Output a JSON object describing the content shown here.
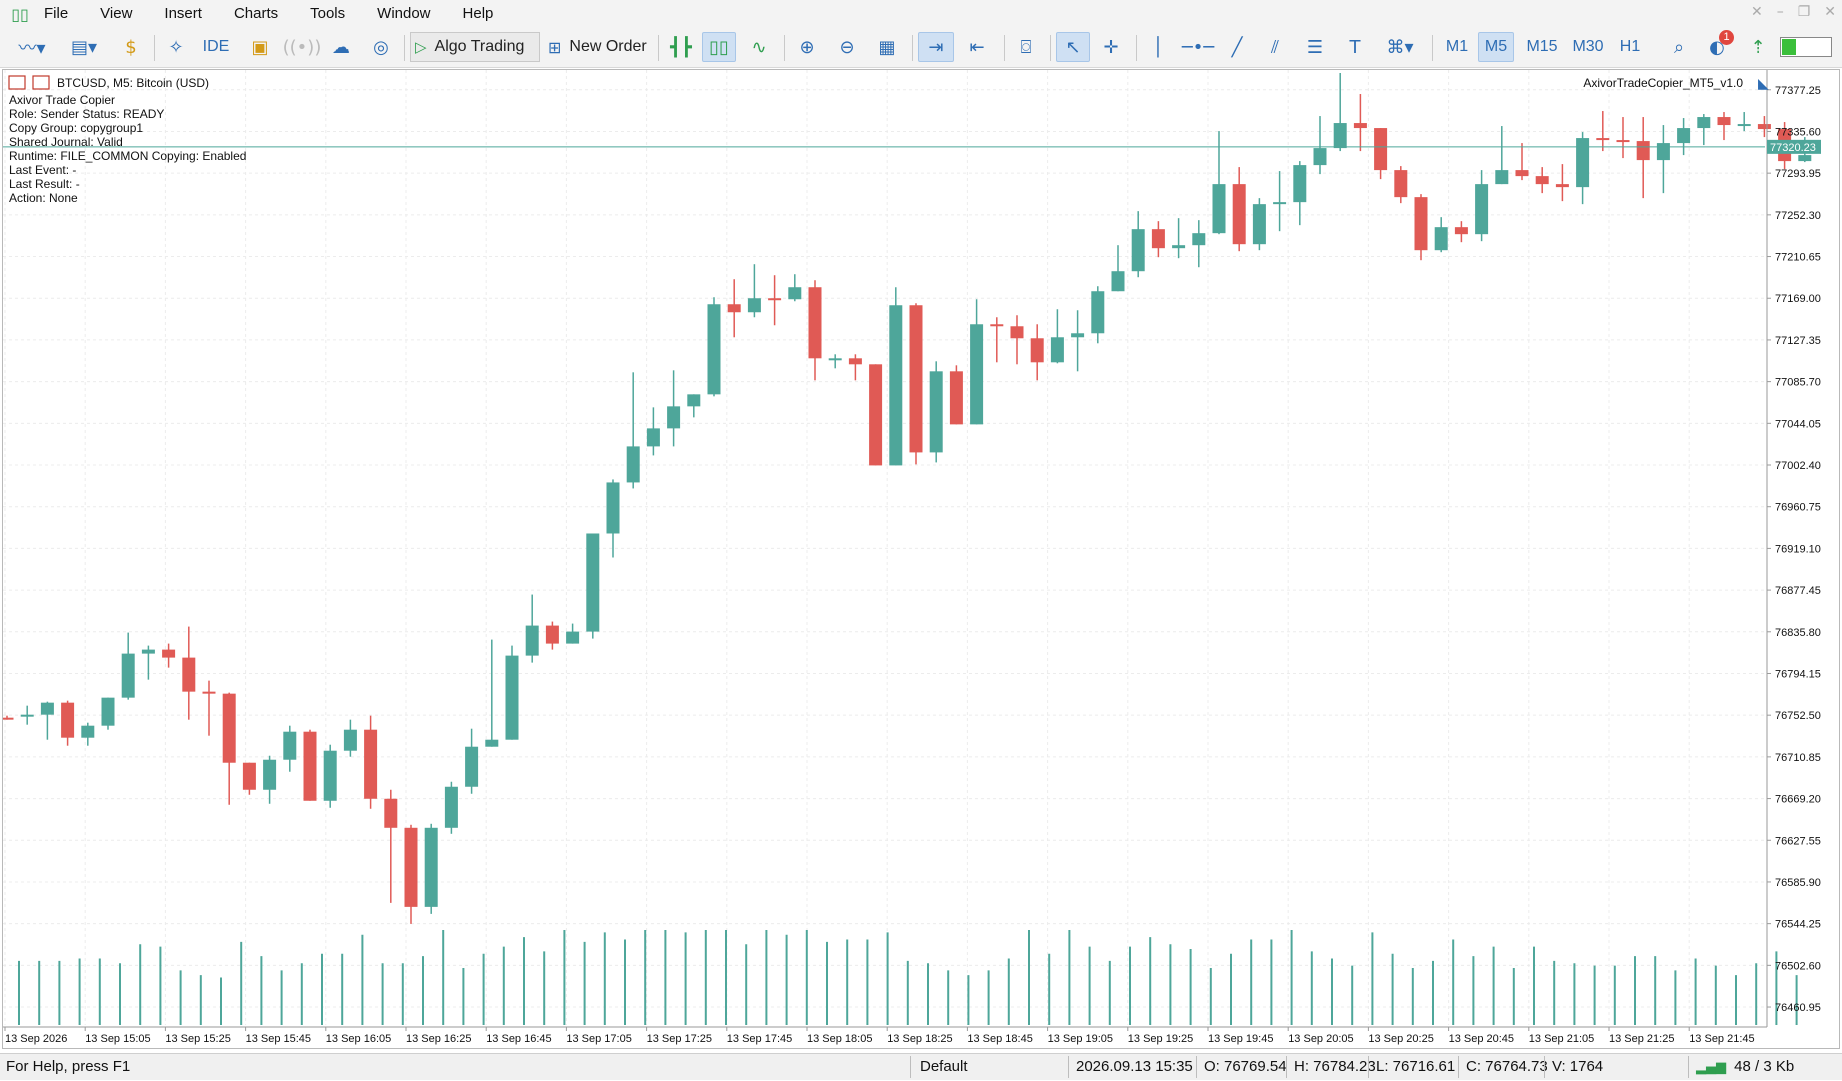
{
  "menu": {
    "items": [
      "File",
      "View",
      "Insert",
      "Charts",
      "Tools",
      "Window",
      "Help"
    ]
  },
  "toolbar": {
    "ide_label": "IDE",
    "algo_trading_label": "Algo Trading",
    "new_order_label": "New Order",
    "timeframes": [
      "M1",
      "M5",
      "M15",
      "M30",
      "H1"
    ],
    "active_timeframe": "M5",
    "alerts_badge": "1"
  },
  "chart": {
    "symbol_header": "BTCUSD, M5:  Bitcoin (USD)",
    "ea_name": "AxivorTradeCopier_MT5_v1.0",
    "info_lines": [
      "Axivor Trade Copier",
      "Role: Sender    Status: READY",
      "Copy Group: copygroup1",
      "Shared Journal: Valid",
      "Runtime: FILE_COMMON    Copying: Enabled",
      "Last Event: -",
      "Last Result: -",
      "Action: None"
    ],
    "current_price": "77320.23",
    "bull_color": "#4ea69a",
    "bear_color": "#e05a55"
  },
  "chart_data": {
    "type": "candlestick",
    "symbol": "BTCUSD",
    "timeframe": "M5",
    "price_ticks": [
      "77377.25",
      "77335.60",
      "77293.95",
      "77252.30",
      "77210.65",
      "77169.00",
      "77127.35",
      "77085.70",
      "77044.05",
      "77002.40",
      "76960.75",
      "76919.10",
      "76877.45",
      "76835.80",
      "76794.15",
      "76752.50",
      "76710.85",
      "76669.20",
      "76627.55",
      "76585.90",
      "76544.25",
      "76502.60",
      "76460.95"
    ],
    "time_ticks": [
      "13 Sep 2026",
      "13 Sep 15:05",
      "13 Sep 15:25",
      "13 Sep 15:45",
      "13 Sep 16:05",
      "13 Sep 16:25",
      "13 Sep 16:45",
      "13 Sep 17:05",
      "13 Sep 17:25",
      "13 Sep 17:45",
      "13 Sep 18:05",
      "13 Sep 18:25",
      "13 Sep 18:45",
      "13 Sep 19:05",
      "13 Sep 19:25",
      "13 Sep 19:45",
      "13 Sep 20:05",
      "13 Sep 20:25",
      "13 Sep 20:45",
      "13 Sep 21:05",
      "13 Sep 21:25",
      "13 Sep 21:45"
    ],
    "ylim": [
      76443,
      77397
    ],
    "current_price": 77320.23,
    "candles": [
      {
        "o": 76750,
        "h": 76752,
        "c": 76749,
        "l": 76748
      },
      {
        "o": 76752,
        "h": 76762,
        "c": 76753,
        "l": 76743
      },
      {
        "o": 76753,
        "h": 76766,
        "c": 76765,
        "l": 76728
      },
      {
        "o": 76765,
        "h": 76767,
        "c": 76730,
        "l": 76722
      },
      {
        "o": 76730,
        "h": 76745,
        "c": 76742,
        "l": 76722
      },
      {
        "o": 76742,
        "h": 76770,
        "c": 76770,
        "l": 76738
      },
      {
        "o": 76770,
        "h": 76835,
        "c": 76814,
        "l": 76768
      },
      {
        "o": 76814,
        "h": 76822,
        "c": 76818,
        "l": 76788
      },
      {
        "o": 76818,
        "h": 76824,
        "c": 76810,
        "l": 76800
      },
      {
        "o": 76810,
        "h": 76841,
        "c": 76776,
        "l": 76748
      },
      {
        "o": 76776,
        "h": 76787,
        "c": 76774,
        "l": 76732
      },
      {
        "o": 76774,
        "h": 76775,
        "c": 76705,
        "l": 76663
      },
      {
        "o": 76705,
        "h": 76705,
        "c": 76678,
        "l": 76673
      },
      {
        "o": 76678,
        "h": 76712,
        "c": 76708,
        "l": 76664
      },
      {
        "o": 76708,
        "h": 76742,
        "c": 76736,
        "l": 76696
      },
      {
        "o": 76736,
        "h": 76738,
        "c": 76667,
        "l": 76667
      },
      {
        "o": 76667,
        "h": 76723,
        "c": 76717,
        "l": 76660
      },
      {
        "o": 76717,
        "h": 76748,
        "c": 76738,
        "l": 76711
      },
      {
        "o": 76738,
        "h": 76752,
        "c": 76669,
        "l": 76659
      },
      {
        "o": 76669,
        "h": 76678,
        "c": 76640,
        "l": 76565
      },
      {
        "o": 76640,
        "h": 76643,
        "c": 76561,
        "l": 76544
      },
      {
        "o": 76561,
        "h": 76644,
        "c": 76640,
        "l": 76554
      },
      {
        "o": 76640,
        "h": 76686,
        "c": 76681,
        "l": 76634
      },
      {
        "o": 76681,
        "h": 76739,
        "c": 76721,
        "l": 76674
      },
      {
        "o": 76721,
        "h": 76828,
        "c": 76728,
        "l": 76730
      },
      {
        "o": 76728,
        "h": 76822,
        "c": 76812,
        "l": 76787
      },
      {
        "o": 76812,
        "h": 76873,
        "c": 76842,
        "l": 76805
      },
      {
        "o": 76842,
        "h": 76846,
        "c": 76824,
        "l": 76818
      },
      {
        "o": 76824,
        "h": 76844,
        "c": 76836,
        "l": 76826
      },
      {
        "o": 76836,
        "h": 76932,
        "c": 76934,
        "l": 76829
      },
      {
        "o": 76934,
        "h": 76988,
        "c": 76985,
        "l": 76910
      },
      {
        "o": 76985,
        "h": 77095,
        "c": 77021,
        "l": 76979
      },
      {
        "o": 77021,
        "h": 77060,
        "c": 77039,
        "l": 77012
      },
      {
        "o": 77039,
        "h": 77097,
        "c": 77061,
        "l": 77021
      },
      {
        "o": 77061,
        "h": 77067,
        "c": 77073,
        "l": 77050
      },
      {
        "o": 77073,
        "h": 77170,
        "c": 77163,
        "l": 77071
      },
      {
        "o": 77163,
        "h": 77188,
        "c": 77155,
        "l": 77130
      },
      {
        "o": 77155,
        "h": 77203,
        "c": 77169,
        "l": 77150
      },
      {
        "o": 77169,
        "h": 77192,
        "c": 77168,
        "l": 77142
      },
      {
        "o": 77168,
        "h": 77193,
        "c": 77180,
        "l": 77166
      },
      {
        "o": 77180,
        "h": 77187,
        "c": 77109,
        "l": 77087
      },
      {
        "o": 77109,
        "h": 77113,
        "c": 77109,
        "l": 77099
      },
      {
        "o": 77109,
        "h": 77113,
        "c": 77103,
        "l": 77087
      },
      {
        "o": 77103,
        "h": 77103,
        "c": 77002,
        "l": 77002
      },
      {
        "o": 77002,
        "h": 77180,
        "c": 77162,
        "l": 77002
      },
      {
        "o": 77162,
        "h": 77164,
        "c": 77015,
        "l": 77003
      },
      {
        "o": 77015,
        "h": 77106,
        "c": 77096,
        "l": 77005
      },
      {
        "o": 77096,
        "h": 77102,
        "c": 77043,
        "l": 77043
      },
      {
        "o": 77043,
        "h": 77168,
        "c": 77143,
        "l": 77043
      },
      {
        "o": 77143,
        "h": 77150,
        "c": 77141,
        "l": 77105
      },
      {
        "o": 77141,
        "h": 77152,
        "c": 77129,
        "l": 77103
      },
      {
        "o": 77129,
        "h": 77143,
        "c": 77105,
        "l": 77087
      },
      {
        "o": 77105,
        "h": 77158,
        "c": 77130,
        "l": 77104
      },
      {
        "o": 77130,
        "h": 77157,
        "c": 77134,
        "l": 77096
      },
      {
        "o": 77134,
        "h": 77181,
        "c": 77176,
        "l": 77124
      },
      {
        "o": 77176,
        "h": 77222,
        "c": 77196,
        "l": 77176
      },
      {
        "o": 77196,
        "h": 77256,
        "c": 77238,
        "l": 77190
      },
      {
        "o": 77238,
        "h": 77246,
        "c": 77219,
        "l": 77210
      },
      {
        "o": 77219,
        "h": 77249,
        "c": 77222,
        "l": 77209
      },
      {
        "o": 77222,
        "h": 77247,
        "c": 77234,
        "l": 77200
      },
      {
        "o": 77234,
        "h": 77336,
        "c": 77283,
        "l": 77233
      },
      {
        "o": 77283,
        "h": 77300,
        "c": 77223,
        "l": 77216
      },
      {
        "o": 77223,
        "h": 77269,
        "c": 77263,
        "l": 77217
      },
      {
        "o": 77263,
        "h": 77296,
        "c": 77265,
        "l": 77236
      },
      {
        "o": 77265,
        "h": 77306,
        "c": 77302,
        "l": 77242
      },
      {
        "o": 77302,
        "h": 77351,
        "c": 77319,
        "l": 77293
      },
      {
        "o": 77319,
        "h": 77394,
        "c": 77344,
        "l": 77316
      },
      {
        "o": 77344,
        "h": 77373,
        "c": 77339,
        "l": 77316
      },
      {
        "o": 77339,
        "h": 77339,
        "c": 77297,
        "l": 77288
      },
      {
        "o": 77297,
        "h": 77301,
        "c": 77270,
        "l": 77264
      },
      {
        "o": 77270,
        "h": 77273,
        "c": 77217,
        "l": 77207
      },
      {
        "o": 77217,
        "h": 77250,
        "c": 77240,
        "l": 77215
      },
      {
        "o": 77240,
        "h": 77246,
        "c": 77233,
        "l": 77225
      },
      {
        "o": 77233,
        "h": 77297,
        "c": 77283,
        "l": 77226
      },
      {
        "o": 77283,
        "h": 77341,
        "c": 77297,
        "l": 77289
      },
      {
        "o": 77297,
        "h": 77324,
        "c": 77291,
        "l": 77287
      },
      {
        "o": 77291,
        "h": 77300,
        "c": 77283,
        "l": 77274
      },
      {
        "o": 77283,
        "h": 77303,
        "c": 77280,
        "l": 77266
      },
      {
        "o": 77280,
        "h": 77335,
        "c": 77329,
        "l": 77263
      },
      {
        "o": 77329,
        "h": 77356,
        "c": 77327,
        "l": 77316
      },
      {
        "o": 77327,
        "h": 77350,
        "c": 77326,
        "l": 77309
      },
      {
        "o": 77326,
        "h": 77350,
        "c": 77307,
        "l": 77269
      },
      {
        "o": 77307,
        "h": 77342,
        "c": 77324,
        "l": 77274
      },
      {
        "o": 77324,
        "h": 77349,
        "c": 77339,
        "l": 77312
      },
      {
        "o": 77339,
        "h": 77353,
        "c": 77350,
        "l": 77322
      },
      {
        "o": 77350,
        "h": 77355,
        "c": 77342,
        "l": 77327
      },
      {
        "o": 77342,
        "h": 77355,
        "c": 77343,
        "l": 77336
      },
      {
        "o": 77343,
        "h": 77351,
        "c": 77338,
        "l": 77330
      },
      {
        "o": 77338,
        "h": 77345,
        "c": 77306,
        "l": 77298
      },
      {
        "o": 77306,
        "h": 77330,
        "c": 77312,
        "l": 77305
      }
    ],
    "volumes": [
      27,
      27,
      27,
      28,
      28,
      26,
      34,
      33,
      23,
      21,
      20,
      35,
      29,
      23,
      26,
      30,
      30,
      38,
      26,
      26,
      29,
      40,
      24,
      30,
      33,
      37,
      31,
      40,
      35,
      39,
      36,
      40,
      40,
      39,
      40,
      40,
      34,
      40,
      38,
      40,
      35,
      36,
      36,
      39,
      27,
      26,
      23,
      21,
      23,
      28,
      40,
      30,
      40,
      33,
      27,
      33,
      37,
      34,
      32,
      24,
      30,
      36,
      36,
      40,
      31,
      28,
      25,
      39,
      30,
      24,
      27,
      36,
      29,
      33,
      24,
      33,
      27,
      26,
      25,
      25,
      29,
      29,
      23,
      28,
      25,
      21,
      26,
      31,
      21
    ]
  },
  "status": {
    "help": "For Help, press F1",
    "profile": "Default",
    "datetime": "2026.09.13 15:35",
    "open": "O: 76769.54",
    "high": "H: 76784.23",
    "low": "L: 76716.61",
    "close": "C: 76764.73",
    "volume": "V: 1764",
    "connection": "48 / 3 Kb"
  }
}
